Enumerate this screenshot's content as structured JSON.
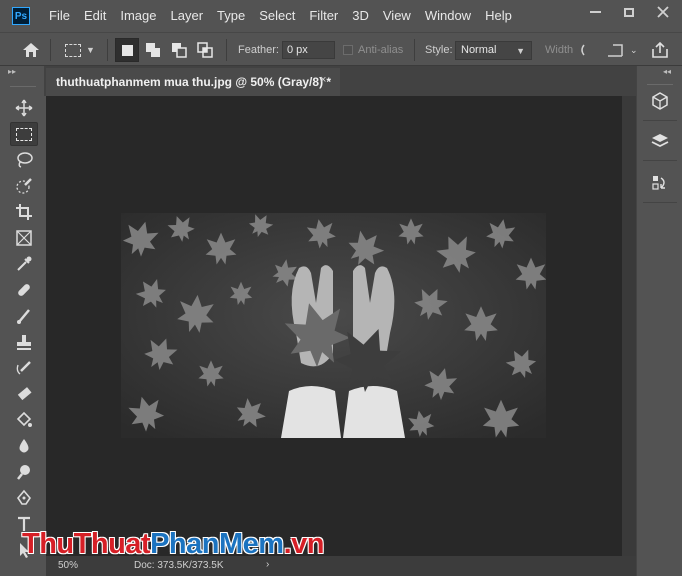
{
  "app": {
    "logo": "Ps"
  },
  "menu": [
    "File",
    "Edit",
    "Image",
    "Layer",
    "Type",
    "Select",
    "Filter",
    "3D",
    "View",
    "Window",
    "Help"
  ],
  "options": {
    "feather_label": "Feather:",
    "feather_value": "0 px",
    "anti_alias_label": "Anti-alias",
    "style_label": "Style:",
    "style_value": "Normal",
    "width_label": "Width"
  },
  "document": {
    "tab_title": "thuthuatphanmem mua thu.jpg @ 50% (Gray/8) *",
    "close_glyph": "×"
  },
  "status": {
    "zoom": "50%",
    "doc_info": "Doc: 373.5K/373.5K",
    "arrow": "›"
  },
  "watermark": {
    "part1": "ThuThuat",
    "part2": "PhanMem",
    "part3": ".vn"
  },
  "tools": [
    "move-tool",
    "rectangular-marquee-tool",
    "lasso-tool",
    "quick-selection-tool",
    "crop-tool",
    "frame-tool",
    "eyedropper-tool",
    "healing-brush-tool",
    "brush-tool",
    "clone-stamp-tool",
    "history-brush-tool",
    "eraser-tool",
    "paint-bucket-tool",
    "blur-tool",
    "dodge-tool",
    "pen-tool",
    "type-tool",
    "path-selection-tool"
  ],
  "dock": [
    "3d-icon",
    "layers-icon",
    "history-icon"
  ],
  "colors": {
    "accent": "#31a8ff",
    "canvas": "#282828",
    "ui": "#535353"
  }
}
